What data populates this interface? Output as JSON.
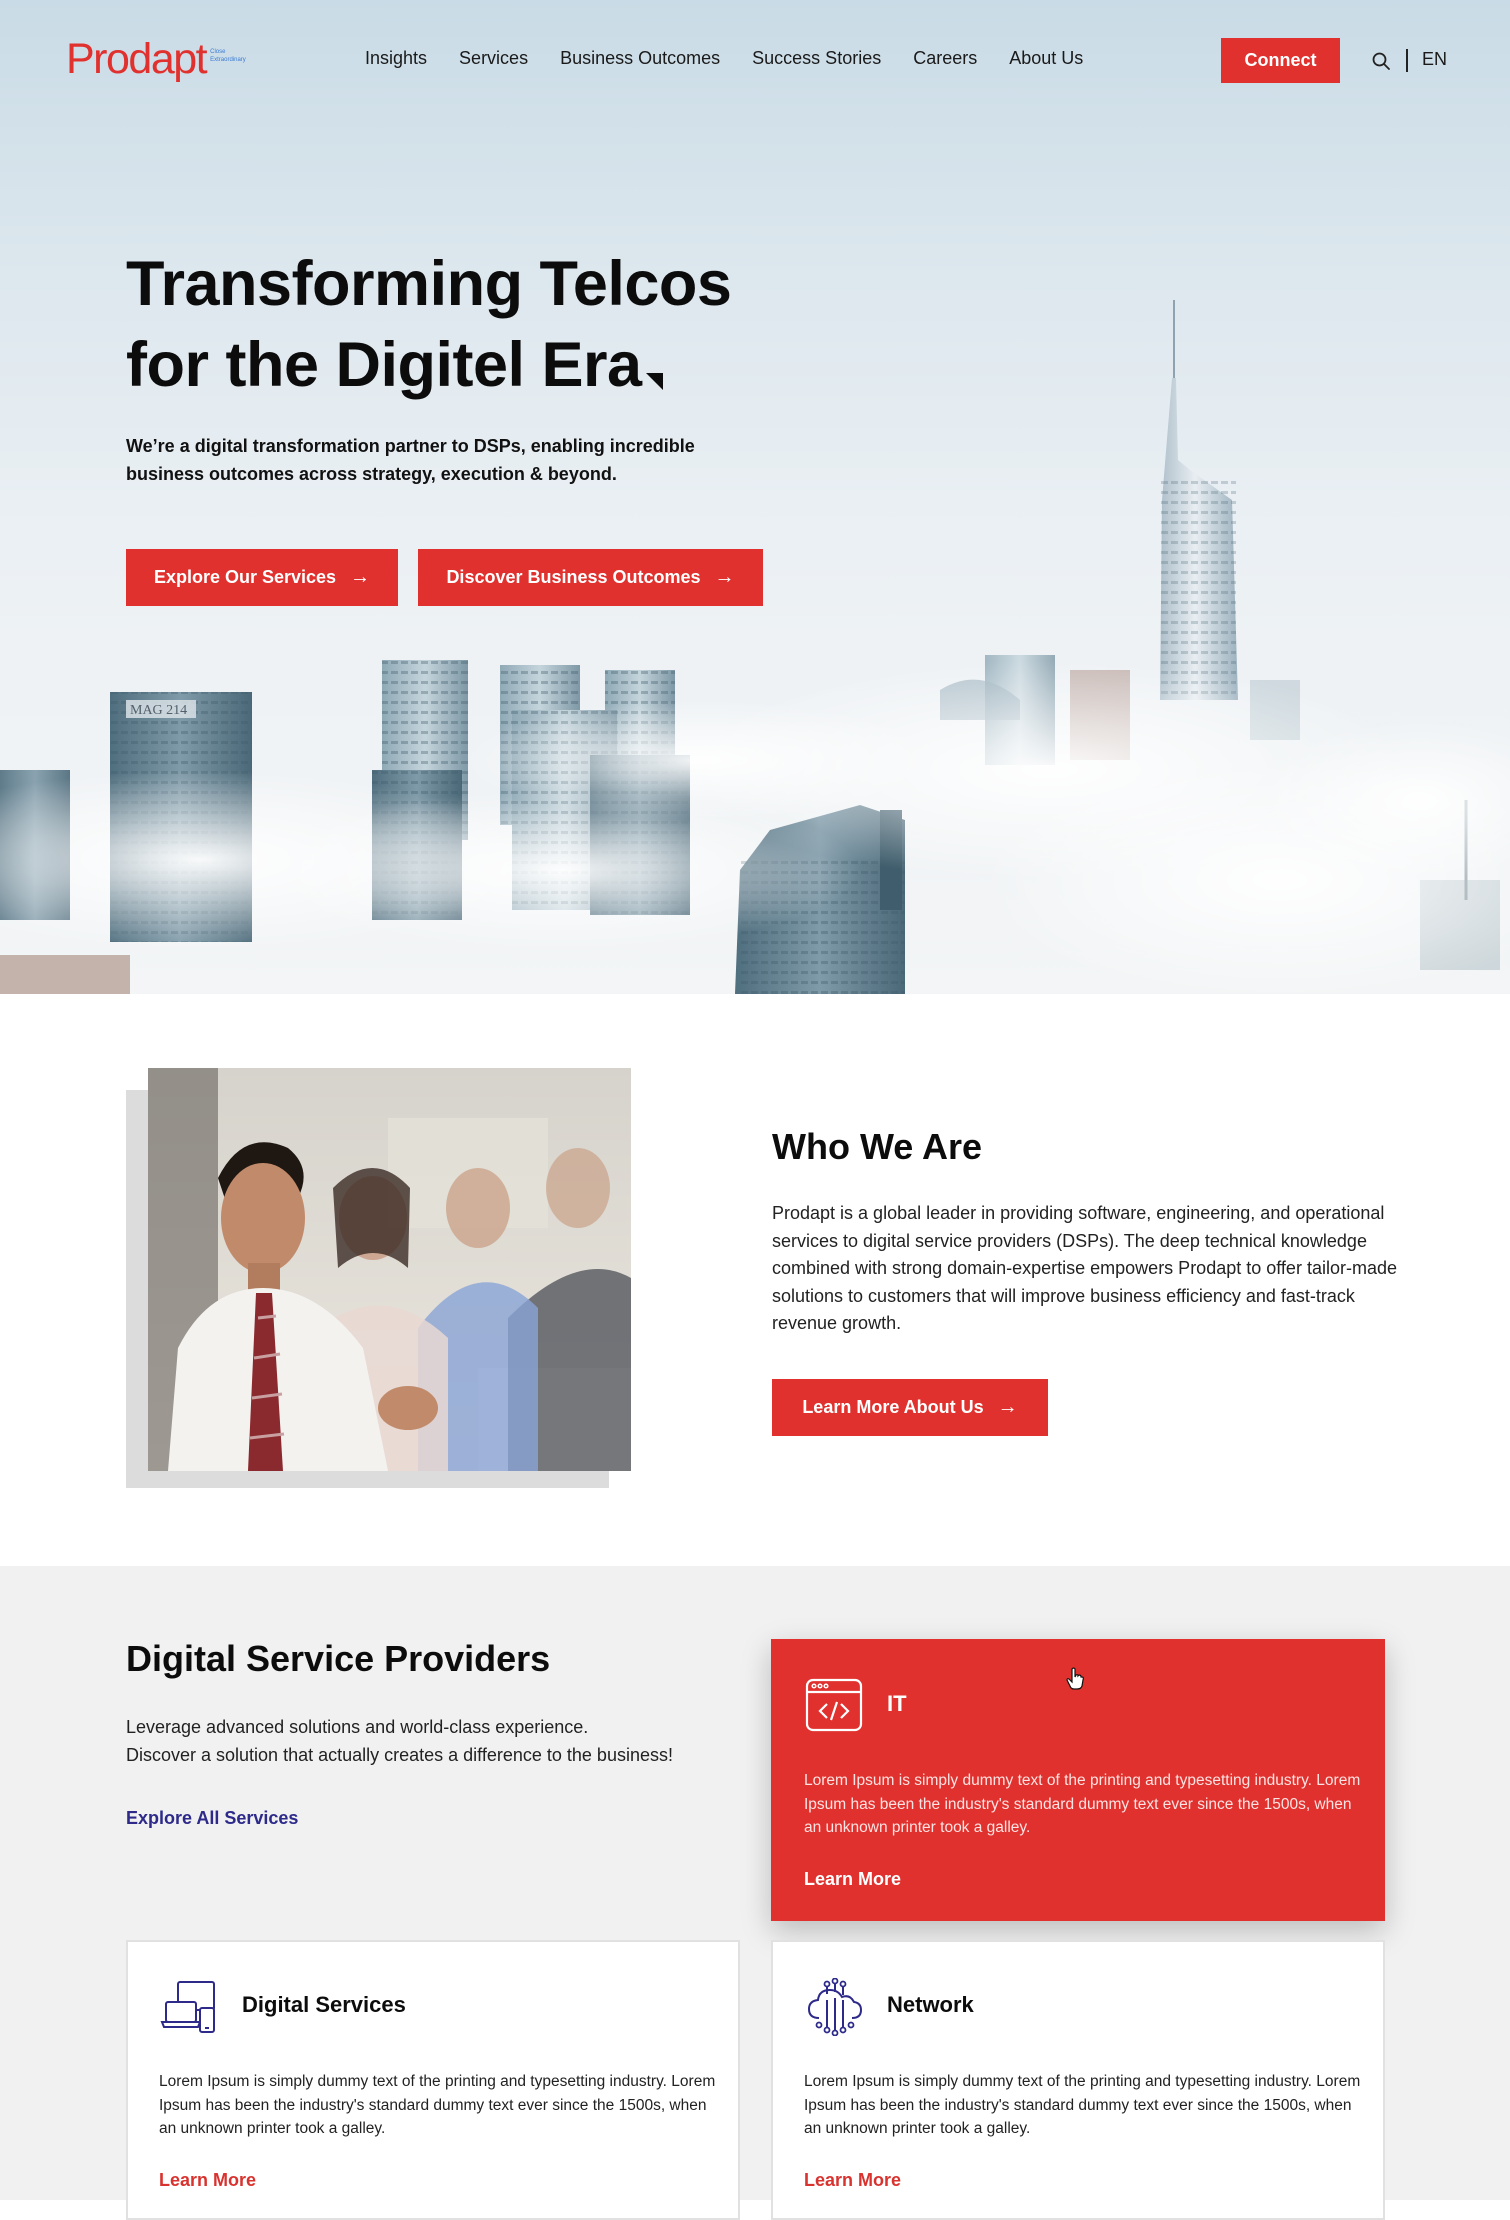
{
  "brand": {
    "name": "Prodapt",
    "tagline": "Close Extraordinary",
    "accent_color": "#e0312e",
    "link_color": "#2d2a8a"
  },
  "nav": {
    "links": [
      "Insights",
      "Services",
      "Business Outcomes",
      "Success Stories",
      "Careers",
      "About Us"
    ],
    "connect_label": "Connect",
    "search_icon": "search-icon",
    "language": "EN"
  },
  "hero": {
    "title_line1": "Transforming Telcos",
    "title_line2": "for the Digitel Era",
    "subtitle": "We’re a digital transformation partner to DSPs, enabling incredible business outcomes across strategy, execution & beyond.",
    "primary_button": "Explore Our Services",
    "secondary_button": "Discover Business Outcomes",
    "building_sign": "MAG 214"
  },
  "who": {
    "title": "Who We Are",
    "text": "Prodapt is a global leader in providing software, engineering, and operational services to digital service providers (DSPs). The deep technical knowledge combined with strong domain-expertise empowers Prodapt to offer tailor-made solutions to customers that will improve business efficiency and fast-track revenue growth.",
    "button": "Learn More About Us"
  },
  "dsp": {
    "title": "Digital Service Providers",
    "text_line1": "Leverage advanced solutions and world-class experience.",
    "text_line2": "Discover a solution that actually creates a difference to the business!",
    "explore_link": "Explore All Services",
    "cards": [
      {
        "title": "IT",
        "icon": "code-window-icon",
        "description": "Lorem Ipsum is simply dummy text of the printing and typesetting industry. Lorem Ipsum has been the industry's standard dummy text ever since the 1500s, when an unknown printer took a galley.",
        "link": "Learn More",
        "active": true
      },
      {
        "title": "Digital Services",
        "icon": "devices-icon",
        "description": "Lorem Ipsum is simply dummy text of the printing and typesetting industry. Lorem Ipsum has been the industry's standard dummy text ever since the 1500s, when an unknown printer took a galley.",
        "link": "Learn More",
        "active": false
      },
      {
        "title": "Network",
        "icon": "cloud-network-icon",
        "description": "Lorem Ipsum is simply dummy text of the printing and typesetting industry. Lorem Ipsum has been the industry's standard dummy text ever since the 1500s, when an unknown printer took a galley.",
        "link": "Learn More",
        "active": false
      }
    ]
  }
}
